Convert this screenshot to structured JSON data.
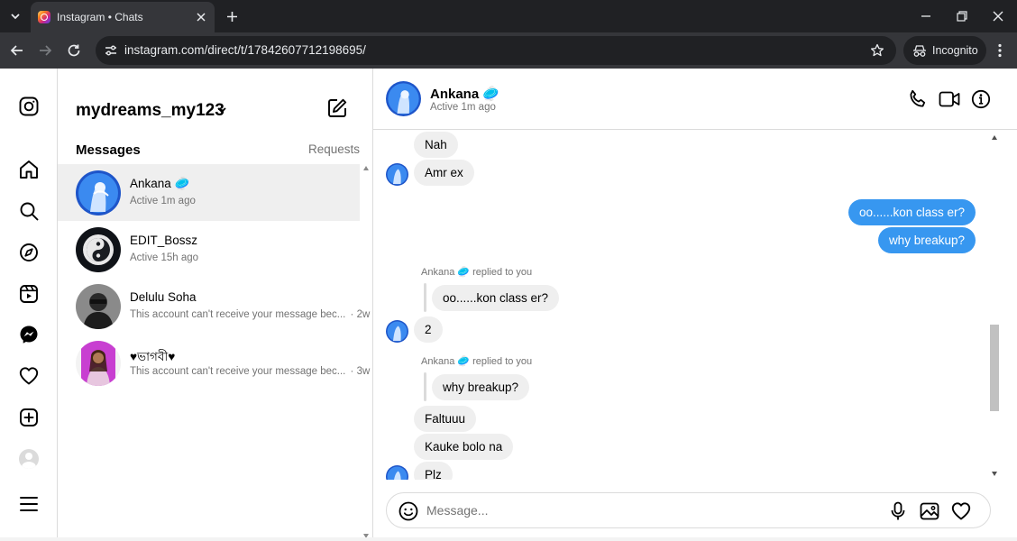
{
  "browser": {
    "tab_title": "Instagram • Chats",
    "url": "instagram.com/direct/t/17842607712198695/",
    "incognito_label": "Incognito"
  },
  "sidebar": {
    "username": "mydreams_my123",
    "messages_label": "Messages",
    "requests_label": "Requests",
    "conversations": [
      {
        "name": "Ankana 🥏",
        "sub": "Active 1m ago",
        "time": "",
        "active": true
      },
      {
        "name": "EDIT_Bossz",
        "sub": "Active 15h ago",
        "time": "",
        "active": false
      },
      {
        "name": "Delulu Soha",
        "sub": "This account can't receive your message bec...",
        "time": "· 2w",
        "active": false
      },
      {
        "name": "♥ভাগবী♥",
        "sub": "This account can't receive your message bec...",
        "time": "· 3w",
        "active": false
      }
    ]
  },
  "chat": {
    "contact_name": "Ankana 🥏",
    "contact_status": "Active 1m ago",
    "messages": [
      {
        "text": "Nah"
      },
      {
        "text": "Amr ex"
      },
      {
        "text": "oo......kon class er?"
      },
      {
        "text": "why breakup?"
      },
      {
        "meta": "Ankana 🥏 replied to you",
        "quoted": "oo......kon class er?"
      },
      {
        "text": "2"
      },
      {
        "meta": "Ankana 🥏 replied to you",
        "quoted": "why breakup?"
      },
      {
        "text": "Faltuuu"
      },
      {
        "text": "Kauke bolo na"
      },
      {
        "text": "Plz"
      }
    ],
    "composer_placeholder": "Message..."
  },
  "colors": {
    "accent_blue": "#3797f0",
    "incoming_bubble": "#efefef",
    "chrome_dark": "#202124",
    "chrome_mid": "#35363a"
  },
  "icons": {
    "rail": [
      "instagram-logo-icon",
      "home-icon",
      "search-icon",
      "explore-icon",
      "reels-icon",
      "messenger-icon",
      "heart-icon",
      "create-icon",
      "profile-avatar",
      "menu-icon"
    ],
    "header": [
      "phone-icon",
      "video-icon",
      "info-icon"
    ],
    "composer": [
      "emoji-icon",
      "microphone-icon",
      "image-icon",
      "heart-icon"
    ]
  }
}
